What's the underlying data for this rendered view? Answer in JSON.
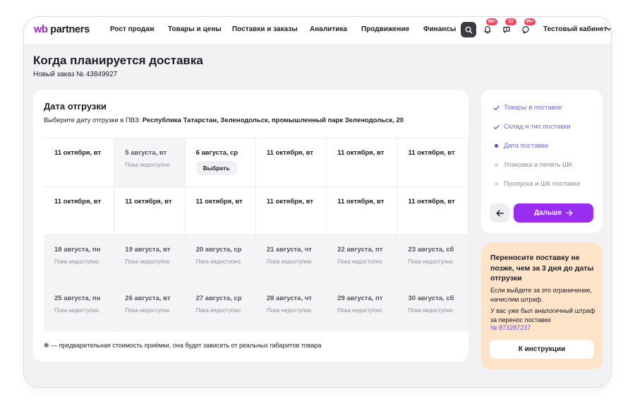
{
  "logo": {
    "wb": "wb",
    "partners": "partners"
  },
  "nav": [
    "Рост продаж",
    "Товары и цены",
    "Поставки и заказы",
    "Аналитика",
    "Продвижение",
    "Финансы"
  ],
  "badges": {
    "notifications": "99+",
    "chat": "32",
    "messages": "99+"
  },
  "cabinet": "Тестовый кабинет",
  "page": {
    "title": "Когда планируется доставка",
    "subtitle": "Новый заказ № 43849927"
  },
  "card": {
    "title": "Дата отгрузки",
    "description_prefix": "Выберите дату отгрузки в ПВЗ: ",
    "description_address": "Республика Татарстан, Зеленодольск, промышленный парк Зеленодольск, 20",
    "footnote": "✻ — предварительная стоимость приёмки, она будет зависеть от реальных габаритов товара"
  },
  "calendar": {
    "rows": [
      [
        {
          "date": "11 октября, вт"
        },
        {
          "date": "5 августа, вт",
          "note": "Пока недоступно",
          "state": "disabled"
        },
        {
          "date": "6 августа, ср",
          "button": "Выбрать"
        },
        {
          "date": "11 октября, вт"
        },
        {
          "date": "11 октября, вт"
        },
        {
          "date": "11 октября, вт"
        }
      ],
      [
        {
          "date": "11 октября, вт"
        },
        {
          "date": "11 октября, вт"
        },
        {
          "date": "11 октября, вт"
        },
        {
          "date": "11 октября, вт"
        },
        {
          "date": "11 октября, вт"
        },
        {
          "date": "11 октября, вт"
        }
      ],
      [
        {
          "date": "18 августа, пн",
          "note": "Пока недоступно",
          "state": "gray"
        },
        {
          "date": "19 августа, вт",
          "note": "Пока недоступно",
          "state": "gray"
        },
        {
          "date": "20 августа, ср",
          "note": "Пока недоступно",
          "state": "gray"
        },
        {
          "date": "21 августа, чт",
          "note": "Пока недоступно",
          "state": "gray"
        },
        {
          "date": "22 августа, пт",
          "note": "Пока недоступно",
          "state": "gray"
        },
        {
          "date": "23 августа, сб",
          "note": "Пока недоступно",
          "state": "gray"
        }
      ],
      [
        {
          "date": "25 августа, пн",
          "note": "Пока недоступно",
          "state": "gray"
        },
        {
          "date": "26 августа, вт",
          "note": "Пока недоступно",
          "state": "gray"
        },
        {
          "date": "27 августа, ср",
          "note": "Пока недоступно",
          "state": "gray"
        },
        {
          "date": "28 августа, чт",
          "note": "Пока недоступно",
          "state": "gray"
        },
        {
          "date": "29 августа, пт",
          "note": "Пока недоступно",
          "state": "gray"
        },
        {
          "date": "30 августа, сб",
          "note": "Пока недоступно",
          "state": "gray"
        }
      ]
    ]
  },
  "steps": [
    {
      "label": "Товары в поставке",
      "status": "done",
      "icon": "check-icon"
    },
    {
      "label": "Склад и тип поставки",
      "status": "done",
      "icon": "check-icon"
    },
    {
      "label": "Дата поставки",
      "status": "current",
      "icon": "current-dot-icon"
    },
    {
      "label": "Упаковка и печать ШК",
      "status": "pending",
      "icon": "pending-dot-icon"
    },
    {
      "label": "Пропуска и ШК поставки",
      "status": "pending",
      "icon": "pending-dot-icon"
    }
  ],
  "buttons": {
    "next": "Дальше",
    "instructions": "К инструкции"
  },
  "info": {
    "title": "Переносите поставку не позже, чем за 3 дня до даты отгрузки",
    "text1": "Если выйдете за это ограничение, начислим штраф.",
    "text2": "У вас уже был аналогичный штраф за перенос поставки",
    "link": "№ 873287237"
  },
  "colors": {
    "accent": "#9a2ef0",
    "brand": "#a322c4",
    "step_active": "#6a6ad8",
    "info_background": "#fde3c8",
    "badge": "#f0455b"
  }
}
